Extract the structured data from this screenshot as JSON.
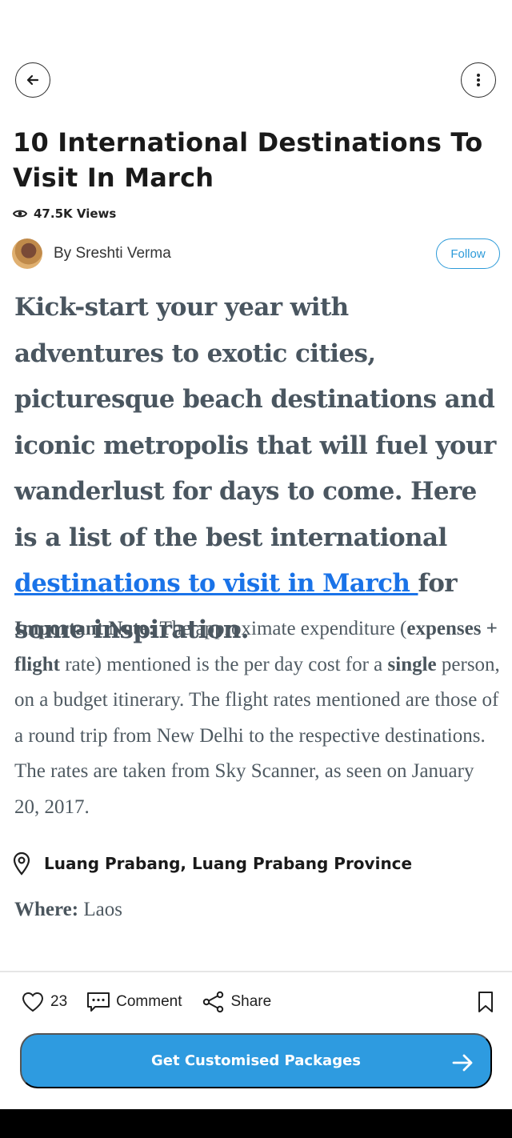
{
  "header": {
    "title": "10 International Destinations To Visit In March",
    "views": "47.5K Views"
  },
  "author": {
    "byline": "By Sreshti Verma",
    "follow_label": "Follow"
  },
  "article": {
    "intro_before_link": "Kick-start your year with adventures to exotic cities, picturesque beach destinations and iconic metropolis that will fuel your wanderlust for days to come. Here is a list of the best international ",
    "intro_link": "destinations to visit in March ",
    "intro_after_link": "for some inspiration.",
    "note_label": "Important Note:",
    "note_text_1": " The approximate expenditure (",
    "note_bold_1": "expenses + flight",
    "note_text_2": " rate) mentioned is the per day cost for a ",
    "note_bold_2": "single",
    "note_text_3": " person, on a budget itinerary. The flight rates mentioned are those of a round trip from New Delhi to the respective destinations. The rates are taken from Sky Scanner, as seen on January 20, 2017.",
    "location": "Luang Prabang, Luang Prabang Province",
    "where_label": "Where:",
    "where_value": " Laos"
  },
  "actions": {
    "likes": "23",
    "comment_label": "Comment",
    "share_label": "Share"
  },
  "cta": {
    "label": "Get Customised Packages"
  },
  "colors": {
    "accent": "#2e9be0",
    "link": "#1a73e8",
    "body_text": "#4f5a62"
  },
  "icons": [
    "back-arrow-icon",
    "more-vertical-icon",
    "eye-icon",
    "location-pin-icon",
    "heart-icon",
    "comment-icon",
    "share-icon",
    "bookmark-icon",
    "arrow-right-icon"
  ]
}
